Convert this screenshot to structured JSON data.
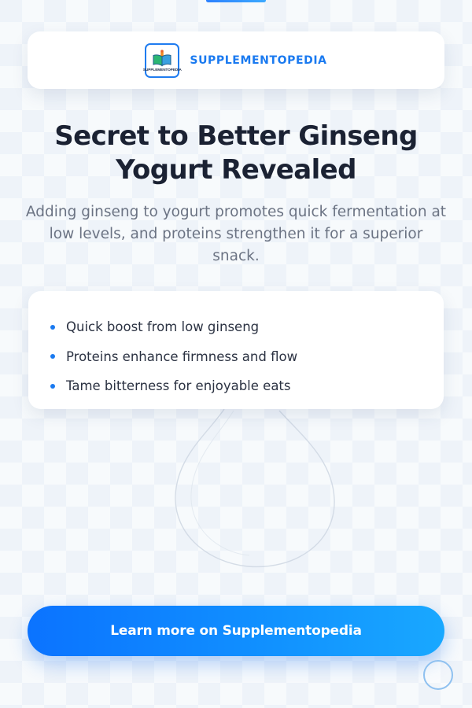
{
  "brand": {
    "name": "SUPPLEMENTOPEDIA",
    "logo_caption": "SUPPLEMENTOPEDIA",
    "logo_icon": "open-book-icon",
    "accent_color": "#1a7af0"
  },
  "main": {
    "headline": "Secret to Better Ginseng Yogurt Revealed",
    "subtext": "Adding ginseng to yogurt promotes quick fermentation at low levels, and proteins strengthen it for a superior snack.",
    "bullets": [
      "Quick boost from low ginseng",
      "Proteins enhance firmness and flow",
      "Tame bitterness for enjoyable eats"
    ]
  },
  "cta": {
    "label": "Learn more on Supplementopedia",
    "gradient_start": "#0b73ff",
    "gradient_end": "#19a8ff"
  },
  "colors": {
    "headline": "#1b2233",
    "body_text": "#6b7383",
    "background": "#eef3f9"
  }
}
